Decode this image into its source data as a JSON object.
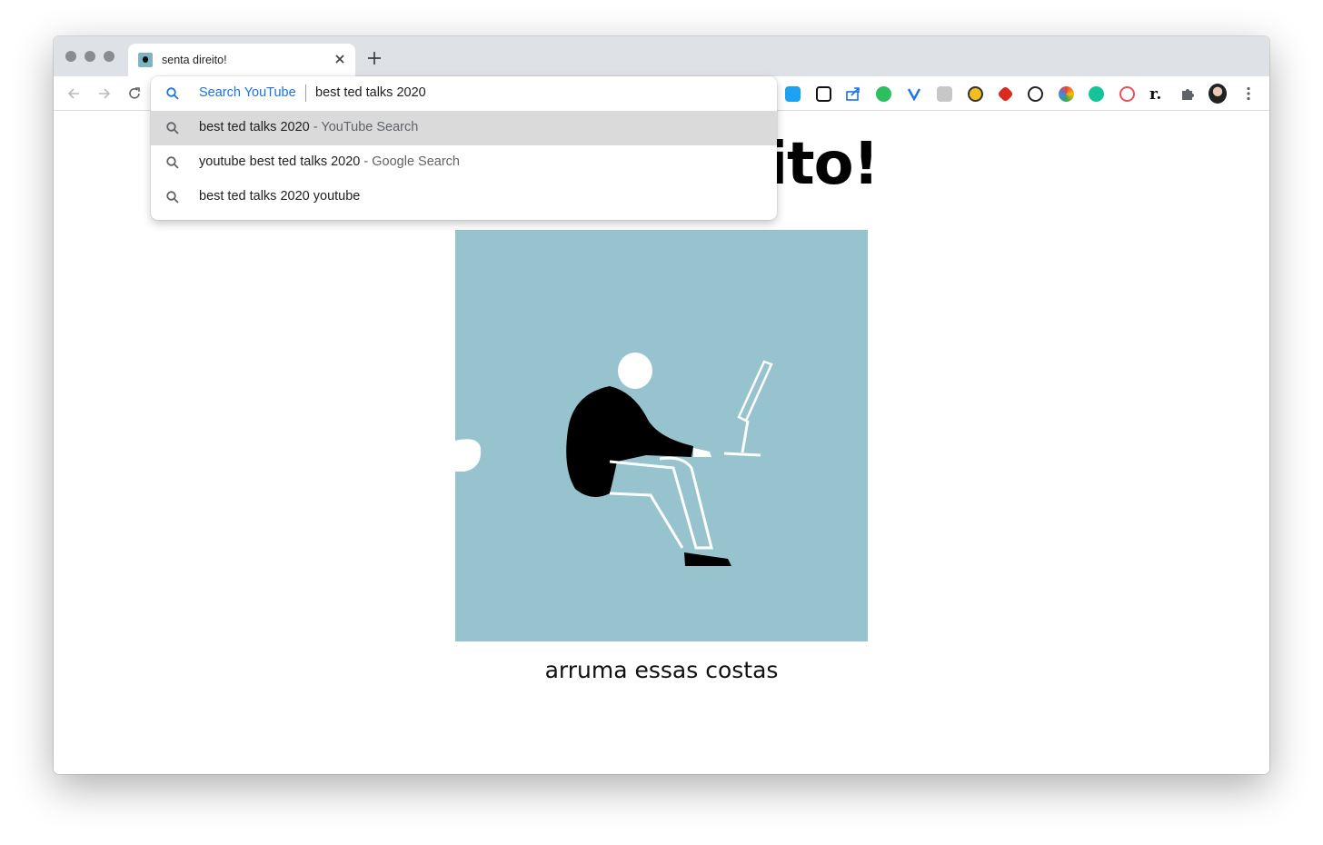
{
  "tab": {
    "title": "senta direito!",
    "favicon": "artwork-favicon"
  },
  "toolbar": {
    "back_icon": "back-arrow-icon",
    "forward_icon": "forward-arrow-icon",
    "reload_icon": "reload-icon"
  },
  "omnibox": {
    "keyword": "Search YouTube",
    "query": "best ted talks 2020",
    "suggestions": [
      {
        "text": "best ted talks 2020",
        "meta": "- YouTube Search",
        "highlighted": true
      },
      {
        "text": "youtube best ted talks 2020",
        "meta": "- Google Search",
        "highlighted": false
      },
      {
        "text": "best ted talks 2020 youtube",
        "meta": "",
        "highlighted": false
      }
    ]
  },
  "extensions": [
    "screenshot-extension-icon",
    "notion-icon",
    "share-icon",
    "evernote-icon",
    "vimeo-icon",
    "monzo-icon",
    "coin-icon",
    "todoist-icon",
    "1password-icon",
    "color-wheel-icon",
    "grammarly-icon",
    "spiral-icon",
    "readwise-icon",
    "puzzle-extensions-icon",
    "profile-avatar",
    "kebab-menu-icon"
  ],
  "page": {
    "title_visible": "ito!",
    "caption": "arruma essas costas"
  },
  "colors": {
    "art_background": "#96c3cd",
    "highlight_row": "#dadada",
    "keyword_blue": "#1a73e8"
  }
}
